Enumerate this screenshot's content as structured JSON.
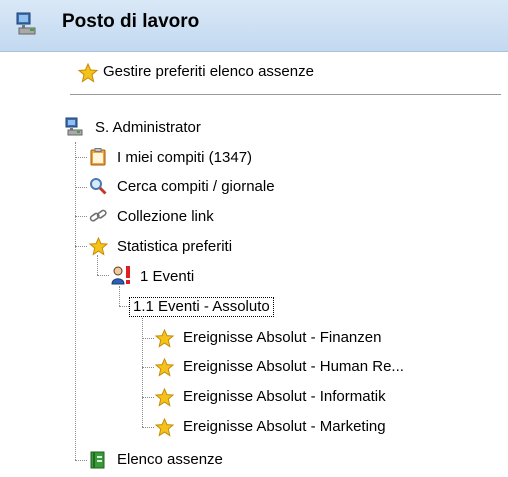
{
  "header": {
    "title": "Posto di lavoro",
    "icon": "workstation-icon"
  },
  "favorites_bar": {
    "label": "Gestire preferiti elenco assenze",
    "icon": "star-icon"
  },
  "tree": {
    "root": {
      "label": "S. Administrator",
      "icon": "workstation-icon"
    },
    "items": [
      {
        "label": "I miei compiti (1347)",
        "icon": "task-list-icon"
      },
      {
        "label": "Cerca compiti / giornale",
        "icon": "magnifier-icon"
      },
      {
        "label": "Collezione link",
        "icon": "link-icon"
      },
      {
        "label": "Statistica preferiti",
        "icon": "star-icon"
      },
      {
        "label": "1 Eventi",
        "icon": "users-alert-icon"
      },
      {
        "label": "1.1 Eventi - Assoluto"
      },
      {
        "label": "Ereignisse Absolut - Finanzen",
        "icon": "star-icon"
      },
      {
        "label": "Ereignisse Absolut - Human Re...",
        "icon": "star-icon"
      },
      {
        "label": "Ereignisse Absolut - Informatik",
        "icon": "star-icon"
      },
      {
        "label": "Ereignisse Absolut - Marketing",
        "icon": "star-icon"
      },
      {
        "label": "Elenco assenze",
        "icon": "book-icon"
      }
    ]
  },
  "colors": {
    "header_bg": "#c9ddf2",
    "star": "#f5c21b",
    "tree_line": "#8c8c8c"
  }
}
